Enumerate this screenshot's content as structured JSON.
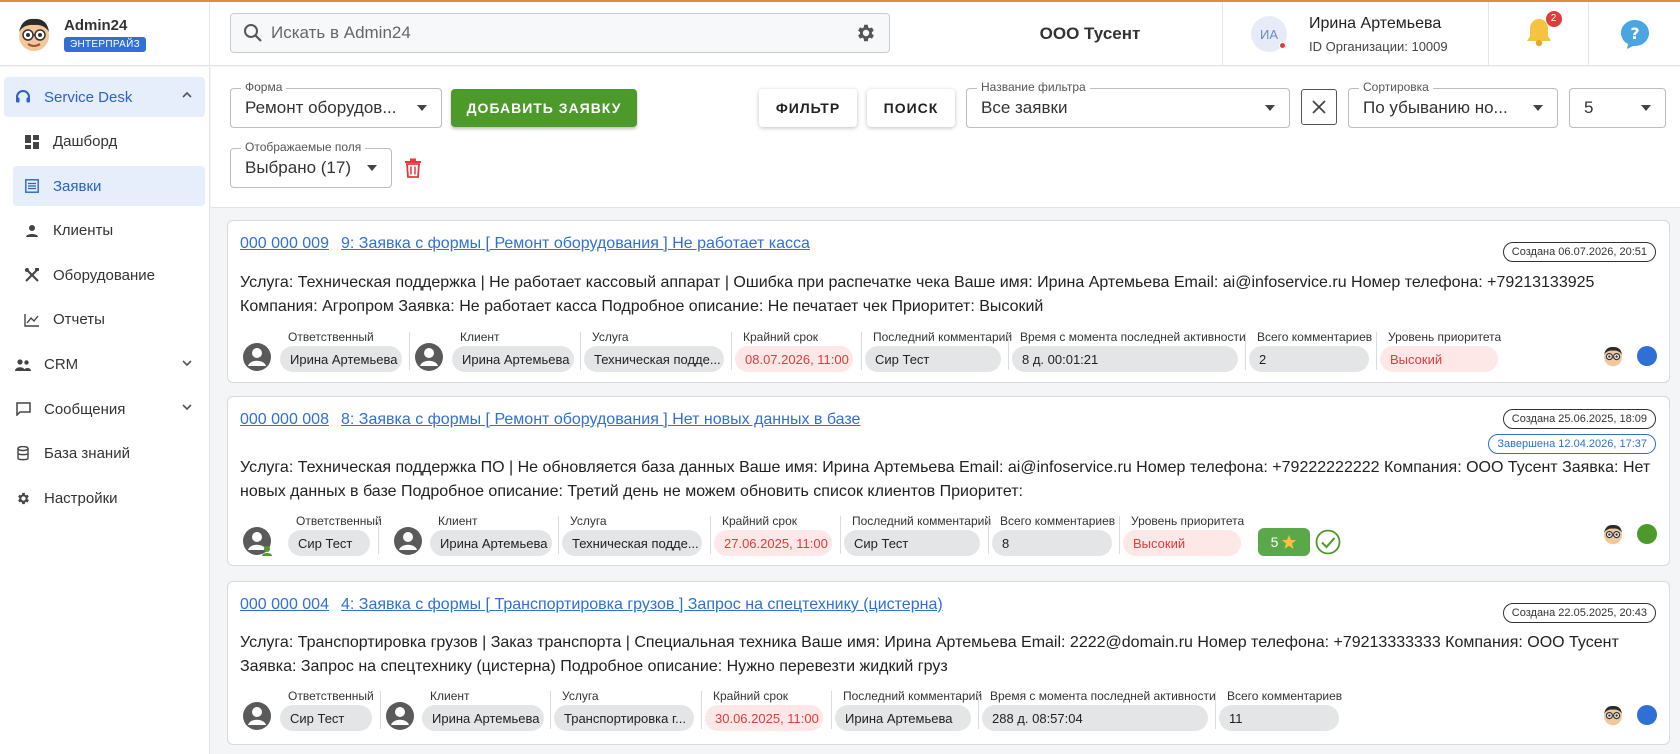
{
  "app": {
    "name": "Admin24",
    "plan": "ЭНТЕРПРАЙЗ"
  },
  "search": {
    "placeholder": "Искать в Admin24"
  },
  "header": {
    "org_name": "ООО Тусент",
    "user_initials": "ИА",
    "user_name": "Ирина Артемьева",
    "org_id": "ID Организации: 10009",
    "notifications": "2"
  },
  "sidebar": {
    "service_desk": "Service Desk",
    "items": [
      "Дашборд",
      "Заявки",
      "Клиенты",
      "Оборудование",
      "Отчеты"
    ],
    "crm": "CRM",
    "messages": "Сообщения",
    "knowledge": "База знаний",
    "settings": "Настройки"
  },
  "toolbar": {
    "form_label": "Форма",
    "form_value": "Ремонт оборудов...",
    "add_button": "ДОБАВИТЬ ЗАЯВКУ",
    "filter_button": "ФИЛЬТР",
    "search_button": "ПОИСК",
    "filter_name_label": "Название фильтра",
    "filter_name_value": "Все заявки",
    "sort_label": "Сортировка",
    "sort_value": "По убыванию но...",
    "per_page": "5",
    "fields_label": "Отображаемые поля",
    "fields_value": "Выбрано (17)"
  },
  "meta_labels": {
    "responsible": "Ответственный",
    "client": "Клиент",
    "service": "Услуга",
    "deadline": "Крайний срок",
    "last_comment": "Последний комментарий",
    "since_activity": "Время с момента последней активности",
    "total_comments": "Всего комментариев",
    "priority": "Уровень приоритета"
  },
  "tickets": [
    {
      "number": "000 000 009",
      "title": "9: Заявка с формы [ Ремонт оборудования ] Не работает касса",
      "created": "Создана 06.07.2026, 20:51",
      "description": "Услуга: Техническая поддержка | Не работает кассовый аппарат | Ошибка при распечатке чека Ваше имя: Ирина Артемьева Email: ai@infoservice.ru Номер телефона: +79213133925 Компания: Агропром Заявка: Не работает касса Подробное описание: Не печатает чек Приоритет: Высокий",
      "responsible": "Ирина Артемьева",
      "client": "Ирина Артемьева",
      "service": "Техническая подде...",
      "deadline": "08.07.2026, 11:00",
      "last_comment": "Сир Тест",
      "since_activity": "8 д. 00:01:21",
      "total_comments": "2",
      "priority": "Высокий",
      "status_color": "#2f6fd6"
    },
    {
      "number": "000 000 008",
      "title": "8: Заявка с формы [ Ремонт оборудования ] Нет новых данных в базе",
      "created": "Создана 25.06.2025, 18:09",
      "completed": "Завершена 12.04.2026, 17:37",
      "description": "Услуга: Техническая поддержка ПО | Не обновляется база данных Ваше имя: Ирина Артемьева Email: ai@infoservice.ru Номер телефона: +79222222222 Компания: ООО Тусент Заявка: Нет новых данных в базе Подробное описание: Третий день не можем обновить список клиентов Приоритет:",
      "responsible": "Сир Тест",
      "client": "Ирина Артемьева",
      "service": "Техническая подде...",
      "deadline": "27.06.2025, 11:00",
      "last_comment": "Сир Тест",
      "total_comments": "8",
      "priority": "Высокий",
      "rating": "5",
      "status_color": "#4c9a2a"
    },
    {
      "number": "000 000 004",
      "title": "4: Заявка с формы [ Транспортировка грузов ] Запрос на спецтехнику (цистерна)",
      "created": "Создана 22.05.2025, 20:43",
      "description": "Услуга: Транспортировка грузов | Заказ транспорта | Специальная техника Ваше имя: Ирина Артемьева Email: 2222@domain.ru Номер телефона: +79213333333 Компания: ООО Тусент Заявка: Запрос на спецтехнику (цистерна) Подробное описание: Нужно перевезти жидкий груз",
      "responsible": "Сир Тест",
      "client": "Ирина Артемьева",
      "service": "Транспортировка г...",
      "deadline": "30.06.2025, 11:00",
      "last_comment": "Ирина Артемьева",
      "since_activity": "288 д. 08:57:04",
      "total_comments": "11",
      "status_color": "#2f6fd6"
    }
  ],
  "colors": {
    "accent": "#2f6fd6",
    "green": "#4c9a2a",
    "red": "#e23b3b"
  }
}
